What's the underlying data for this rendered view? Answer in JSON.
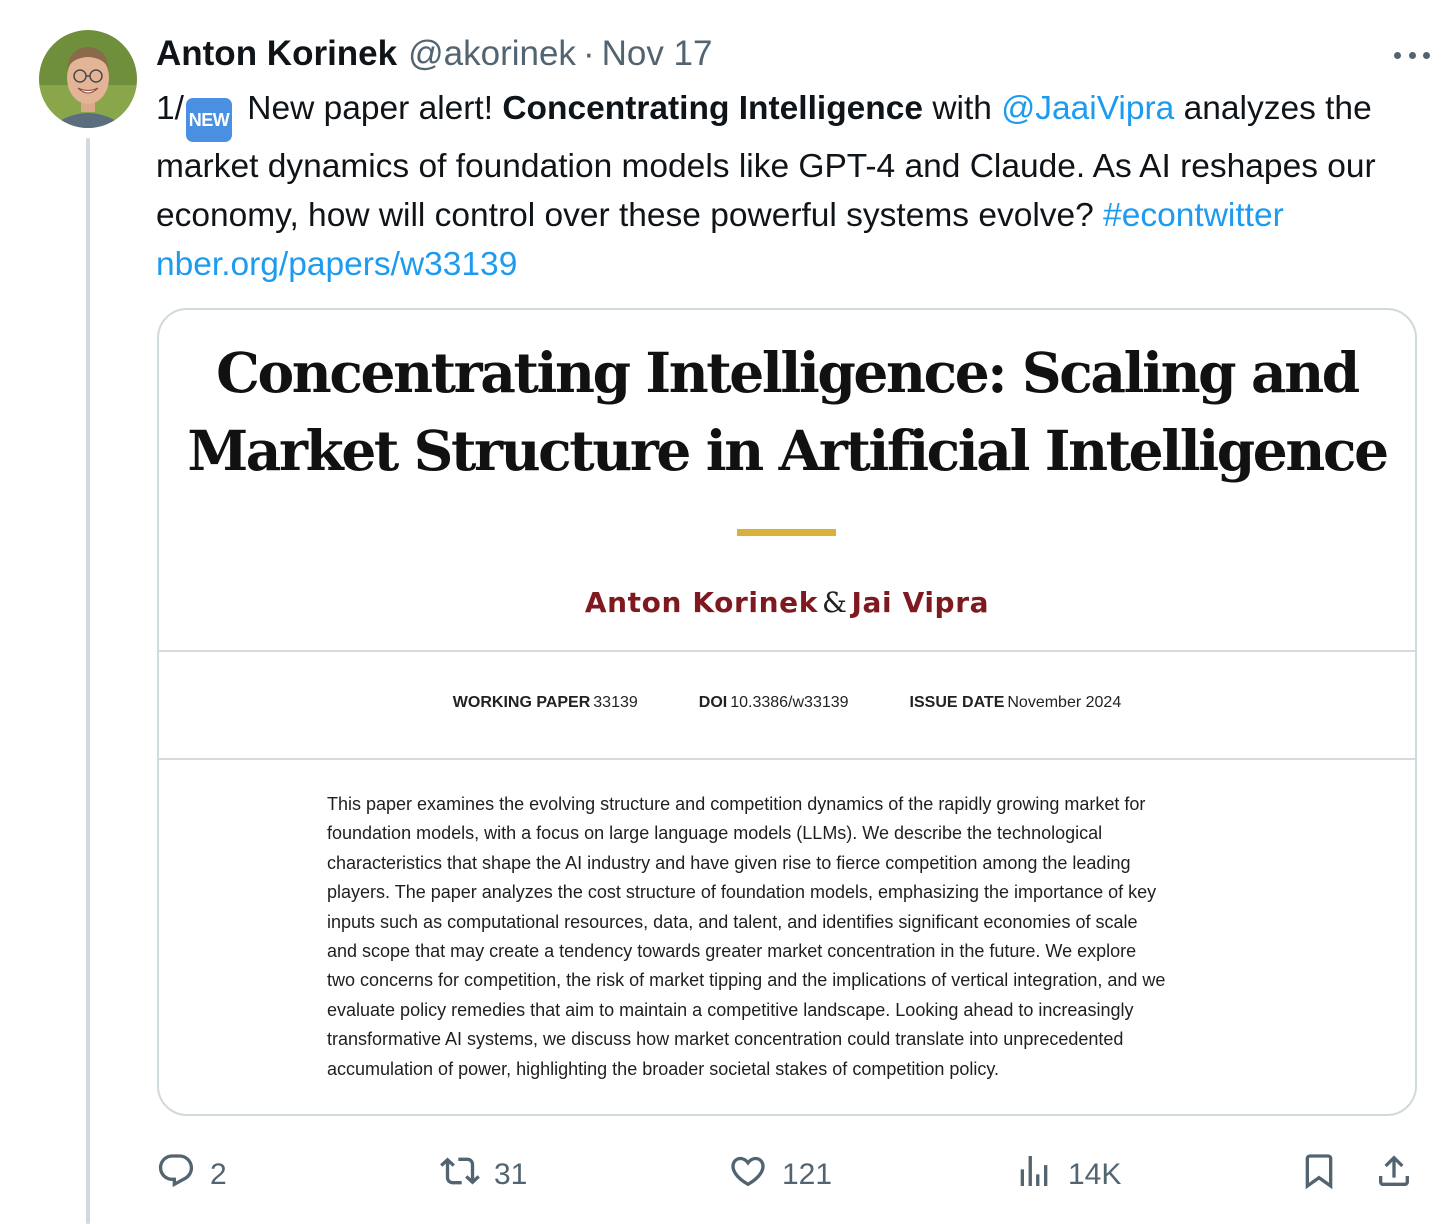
{
  "author": {
    "name": "Anton Korinek",
    "handle": "@akorinek",
    "separator": "·",
    "date": "Nov 17"
  },
  "tweet": {
    "prefix": "1/",
    "badge": "NEW",
    "text_1": " New paper alert! ",
    "bold_title": "Concentrating Intelligence",
    "text_2": " with ",
    "mention": "@JaaiVipra",
    "text_3": " analyzes the market dynamics of foundation models like GPT-4 and Claude. As AI reshapes our economy, how will control over these powerful systems evolve? ",
    "hashtag": "#econtwitter",
    "url": "nber.org/papers/w33139"
  },
  "card": {
    "title_line1": "Concentrating Intelligence: Scaling and",
    "title_line2": "Market Structure in Artificial Intelligence",
    "author1": "Anton Korinek",
    "ampersand": "&",
    "author2": "Jai Vipra",
    "meta": {
      "wp_label": "WORKING PAPER",
      "wp_value": "33139",
      "doi_label": "DOI",
      "doi_value": "10.3386/w33139",
      "issue_label": "ISSUE DATE",
      "issue_value": "November 2024"
    },
    "abstract_lines": [
      "This paper examines the evolving structure and competition dynamics of the rapidly growing market for",
      "foundation models, with a focus on large language models (LLMs). We describe the technological",
      "characteristics that shape the AI industry and have given rise to fierce competition among the leading",
      "players. The paper analyzes the cost structure of foundation models, emphasizing the importance of key",
      "inputs such as computational resources, data, and talent, and identifies significant economies of scale",
      "and scope that may create a tendency towards greater market concentration in the future. We explore",
      "two concerns for competition, the risk of market tipping and the implications of vertical integration, and we",
      "evaluate policy remedies that aim to maintain a competitive landscape. Looking ahead to increasingly",
      "transformative AI systems, we discuss how market concentration could translate into unprecedented",
      "accumulation of power, highlighting the broader societal stakes of competition policy."
    ]
  },
  "actions": {
    "replies": "2",
    "reposts": "31",
    "likes": "121",
    "views": "14K"
  },
  "icons": [
    "more-icon",
    "reply-icon",
    "repost-icon",
    "like-icon",
    "views-icon",
    "bookmark-icon",
    "share-icon"
  ],
  "colors": {
    "link": "#1d9bf0",
    "muted": "#536471",
    "author_red": "#7e1a1f",
    "gold_rule": "#d8b13b",
    "new_badge": "#4a90e2"
  }
}
